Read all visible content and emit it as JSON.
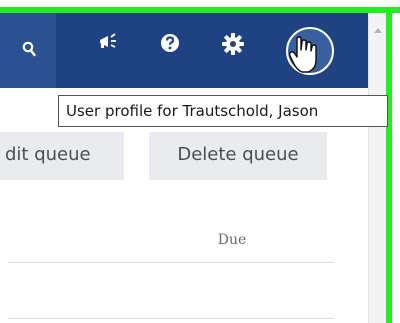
{
  "tooltip": {
    "text": "User profile for Trautschold, Jason"
  },
  "toolbar": {
    "edit_queue_label": "dit queue",
    "delete_queue_label": "Delete queue"
  },
  "table": {
    "columns": [
      "Due"
    ]
  },
  "icons": {
    "search": "search-icon",
    "notifications": "megaphone-icon",
    "help": "help-icon",
    "settings": "gear-icon",
    "avatar": "user-avatar-icon",
    "cursor": "hand-pointer-cursor"
  },
  "colors": {
    "header_bg": "#1f4283",
    "search_bg": "#2c5192",
    "highlight": "#22ee22",
    "button_bg": "#e9ebee"
  }
}
